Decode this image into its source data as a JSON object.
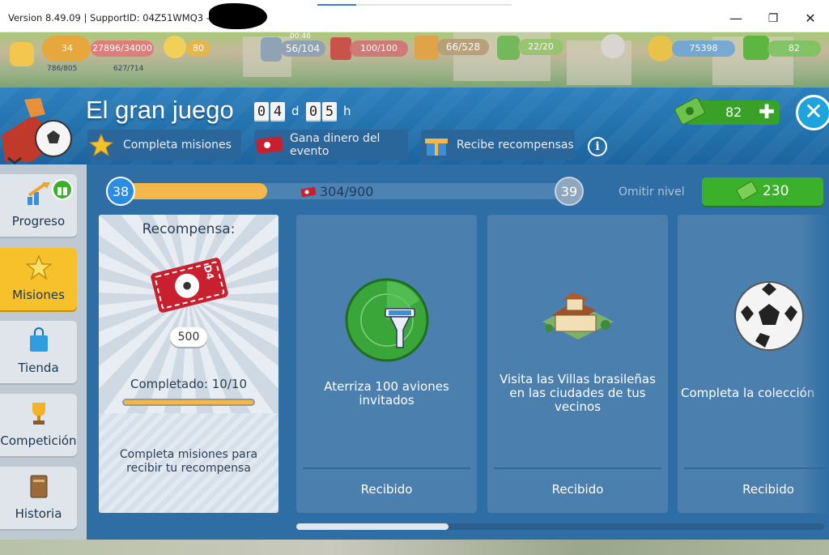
{
  "window": {
    "title": "Version 8.49.09 | SupportID: 04Z51WMQ3 - Ai",
    "minimize": "—",
    "maximize": "❐",
    "close": "✕"
  },
  "hud": {
    "level": "34",
    "xp": "27896/34000",
    "stars": "80",
    "population": "786/805",
    "energy": "627/714",
    "timer": "00:46",
    "fuel": "56/104",
    "cargo": "100/100",
    "storage": "66/528",
    "seats": "22/20",
    "coins": "75398",
    "cash": "82"
  },
  "event": {
    "title": "El gran juego",
    "days_digits": [
      "0",
      "4"
    ],
    "days_unit": "d",
    "hours_digits": [
      "0",
      "5"
    ],
    "hours_unit": "h",
    "tabs": {
      "missions": "Completa misiones",
      "earn_money_line1": "Gana dinero del",
      "earn_money_line2": "evento",
      "rewards": "Recibe recompensas"
    },
    "info": "i",
    "cash": "82",
    "close": "✕"
  },
  "sidebar": {
    "items": [
      {
        "label": "Progreso",
        "icon": "progress-chart-icon"
      },
      {
        "label": "Misiones",
        "icon": "star-icon"
      },
      {
        "label": "Tienda",
        "icon": "shopping-bag-icon"
      },
      {
        "label": "Competición",
        "icon": "trophy-icon"
      },
      {
        "label": "Historia",
        "icon": "book-icon"
      }
    ],
    "active": "Misiones"
  },
  "progress": {
    "current_level": "38",
    "next_level": "39",
    "points": "304/900",
    "fraction": 0.338,
    "skip_label": "Omitir nivel",
    "skip_cost": "230"
  },
  "reward": {
    "title": "Recompensa:",
    "ticket_label": "D4",
    "amount": "500",
    "completed": "Completado: 10/10",
    "completed_fraction": 1.0,
    "description": "Completa misiones para recibir tu recompensa"
  },
  "missions": [
    {
      "text": "Aterriza 100 aviones invitados",
      "status": "Recibido",
      "icon": "radar-tower-icon"
    },
    {
      "text": "Visita las Villas brasileñas en las ciudades de tus vecinos",
      "status": "Recibido",
      "icon": "villa-building-icon"
    },
    {
      "text": "Completa la colección",
      "status": "Recibido",
      "icon": "soccer-ball-icon"
    }
  ],
  "colors": {
    "header_blue": "#2170ab",
    "panel_blue": "#2e6ea5",
    "active_tab": "#f7c12b",
    "green_button": "#3bb02a",
    "progress_orange": "#f4b84a"
  }
}
